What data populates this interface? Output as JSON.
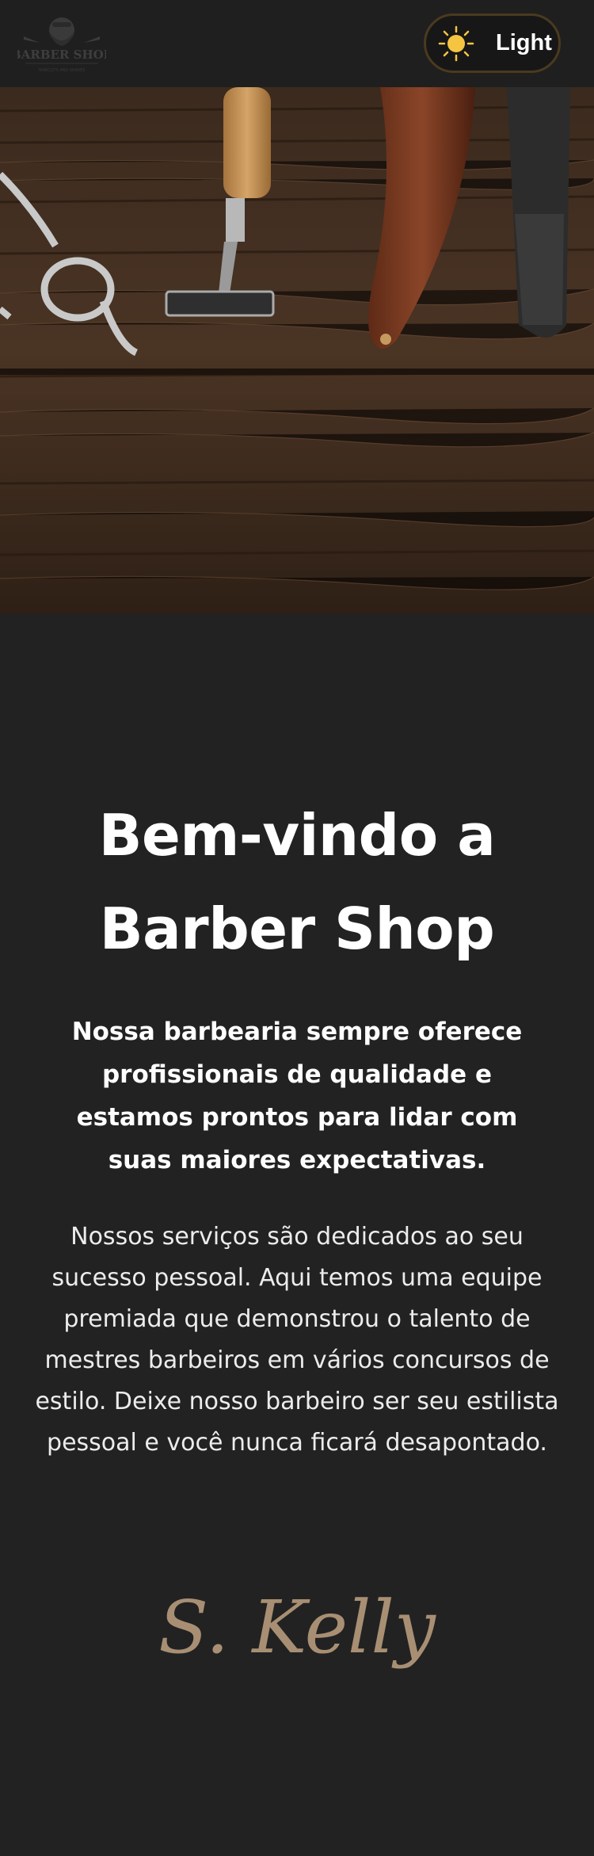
{
  "header": {
    "logo_text": "BARBER SHOP",
    "logo_tagline": "HAIRCUTS AND SHAVES",
    "theme_toggle_label": "Light",
    "theme_icon": "sun-icon"
  },
  "hero": {
    "image": "barber-tools-on-wood"
  },
  "main": {
    "title": "Bem-vindo a Barber Shop",
    "subtitle": "Nossa barbearia sempre oferece profissionais de qualidade e estamos prontos para lidar com suas maiores expectativas.",
    "body": "Nossos serviços são dedicados ao seu sucesso pessoal. Aqui temos uma equipe premiada que demonstrou o talento de mestres barbeiros em vários concursos de estilo. Deixe nosso barbeiro ser seu estilista pessoal e você nunca ficará desapontado.",
    "signature": "S. Kelly"
  },
  "colors": {
    "background": "#222222",
    "accent": "#a88f73",
    "sun": "#f5c542"
  }
}
